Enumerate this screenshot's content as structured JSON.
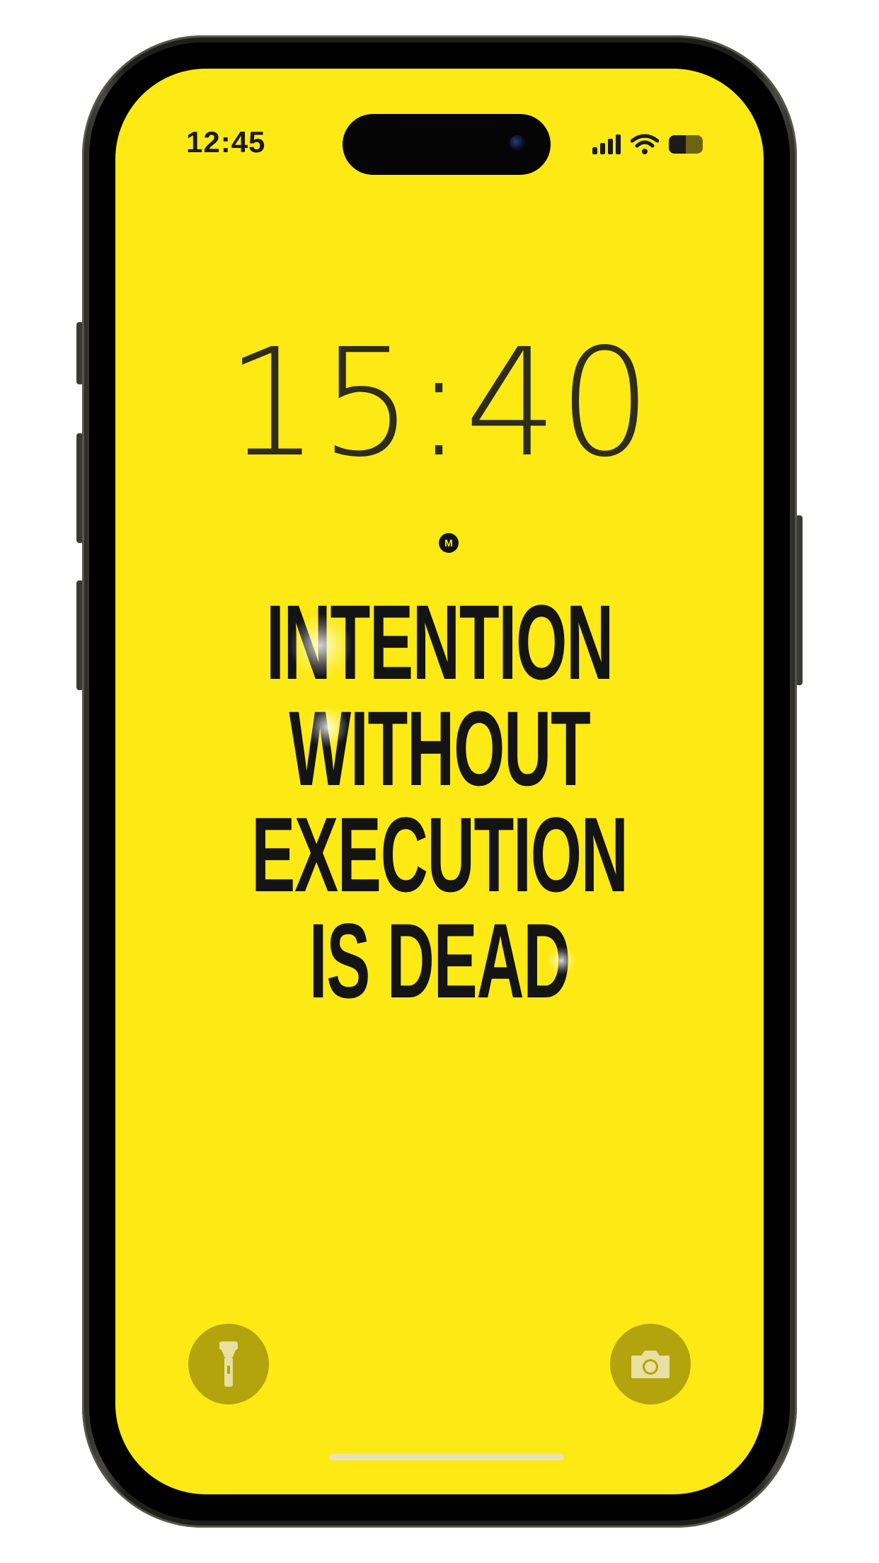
{
  "status_bar": {
    "time": "12:45",
    "signal_bars": 4,
    "wifi": "wifi-icon",
    "battery_level": 0.5
  },
  "lock_screen": {
    "clock": "15:40",
    "logo_letter": "M",
    "quote_lines": [
      "INTENTION",
      "WITHOUT",
      "EXECUTION",
      "IS DEAD"
    ]
  },
  "controls": {
    "left_icon": "flashlight-icon",
    "right_icon": "camera-icon"
  },
  "colors": {
    "wallpaper": "#fdea14",
    "text": "#141414",
    "control_bg": "#b3a30d"
  }
}
